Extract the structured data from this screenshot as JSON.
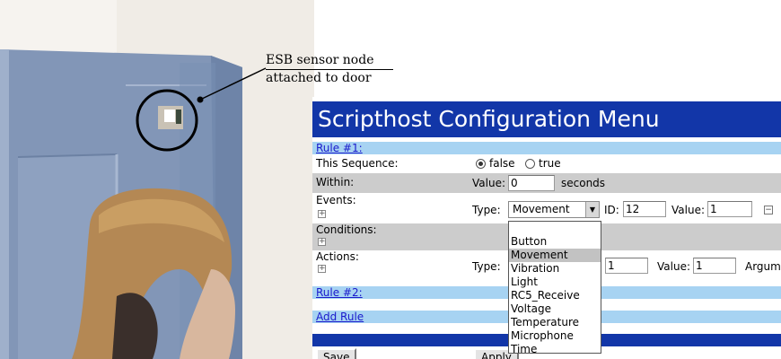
{
  "annotation": {
    "line1": "ESB sensor node",
    "line2": "attached to door"
  },
  "page": {
    "title": "Scripthost Configuration Menu",
    "rule1_link": "Rule #1:",
    "this_sequence_label": "This Sequence:",
    "radio_false": "false",
    "radio_true": "true",
    "within_label": "Within:",
    "value_label": "Value:",
    "within_value": "0",
    "seconds_label": "seconds",
    "events_label": "Events:",
    "type_label": "Type:",
    "event_type_value": "Movement",
    "id_label": "ID:",
    "event_id_value": "12",
    "event_value": "1",
    "conditions_label": "Conditions:",
    "actions_label": "Actions:",
    "action_id_value": "1",
    "action_value": "1",
    "argument_label": "Argum",
    "rule2_link": "Rule #2:",
    "add_rule_link": "Add Rule",
    "save_button": "Save",
    "apply_button": "Apply",
    "plus_glyph": "+",
    "minus_glyph": "−",
    "dropdown_arrow": "▼"
  },
  "dropdown": {
    "options": [
      "",
      "Button",
      "Movement",
      "Vibration",
      "Light",
      "RC5_Receive",
      "Voltage",
      "Temperature",
      "Microphone",
      "Time"
    ],
    "selected": "Movement"
  },
  "colors": {
    "title_bar": "#1236a8",
    "rule_bar": "#a7d3f2",
    "grey_row": "#cccccc",
    "door": "#7f94b6"
  }
}
